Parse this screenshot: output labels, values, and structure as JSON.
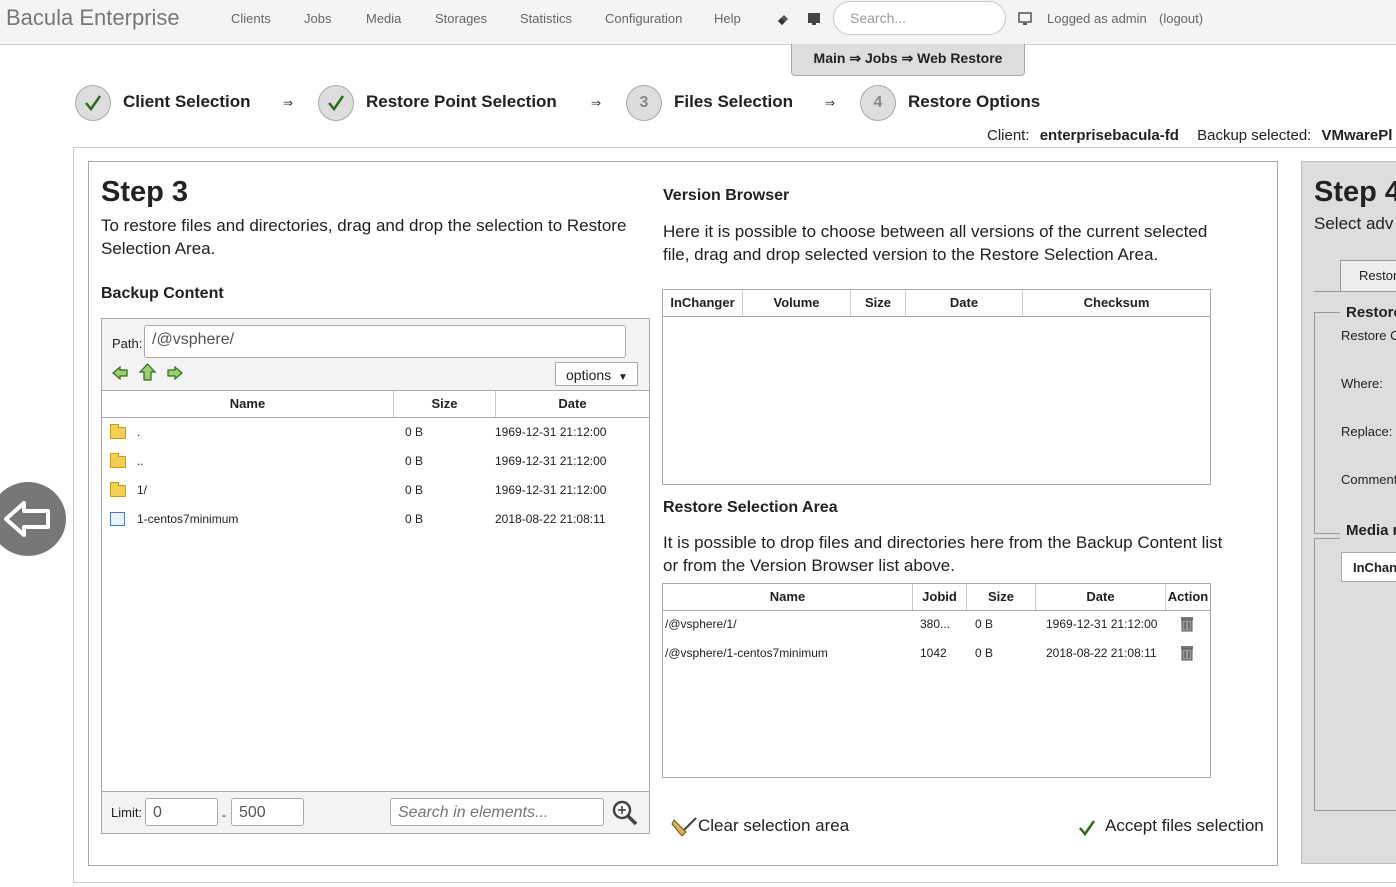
{
  "app": {
    "brand": "Bacula Enterprise"
  },
  "nav": [
    "Clients",
    "Jobs",
    "Media",
    "Storages",
    "Statistics",
    "Configuration",
    "Help"
  ],
  "search": {
    "placeholder": "Search..."
  },
  "user": {
    "logged": "Logged as admin",
    "logout": "(logout)"
  },
  "breadcrumb": "Main ⇒ Jobs ⇒ Web Restore",
  "steps": [
    {
      "label": "Client Selection",
      "state": "done"
    },
    {
      "label": "Restore Point Selection",
      "state": "done"
    },
    {
      "label": "Files Selection",
      "num": "3"
    },
    {
      "label": "Restore Options",
      "num": "4"
    }
  ],
  "step_arrow": "⇒",
  "status": {
    "client_label": "Client:",
    "client_value": "enterprisebacula-fd",
    "backup_label": "Backup selected:",
    "backup_value": "VMwarePl"
  },
  "step3": {
    "title": "Step 3",
    "description": "To restore files and directories, drag and drop the selection to Restore Selection Area.",
    "backup_content": {
      "heading": "Backup Content",
      "path_label": "Path:",
      "path_value": "/@vsphere/",
      "options_label": "options",
      "columns": [
        "Name",
        "Size",
        "Date"
      ],
      "rows": [
        {
          "name": ".",
          "size": "0 B",
          "date": "1969-12-31 21:12:00",
          "type": "folder"
        },
        {
          "name": "..",
          "size": "0 B",
          "date": "1969-12-31 21:12:00",
          "type": "folder"
        },
        {
          "name": "1/",
          "size": "0 B",
          "date": "1969-12-31 21:12:00",
          "type": "folder"
        },
        {
          "name": "1-centos7minimum",
          "size": "0 B",
          "date": "2018-08-22 21:08:11",
          "type": "file"
        }
      ],
      "limit_label": "Limit:",
      "limit_from": "0",
      "limit_dash": "-",
      "limit_to": "500",
      "search_placeholder": "Search in elements..."
    },
    "version_browser": {
      "heading": "Version Browser",
      "description": "Here it is possible to choose between all versions of the current selected file, drag and drop selected version to the Restore Selection Area.",
      "columns": [
        "InChanger",
        "Volume",
        "Size",
        "Date",
        "Checksum"
      ]
    },
    "restore_area": {
      "heading": "Restore Selection Area",
      "description": "It is possible to drop files and directories here from the Backup Content list or from the Version Browser list above.",
      "columns": [
        "Name",
        "Jobid",
        "Size",
        "Date",
        "Action"
      ],
      "rows": [
        {
          "name": "/@vsphere/1/",
          "jobid": "380...",
          "size": "0 B",
          "date": "1969-12-31 21:12:00"
        },
        {
          "name": "/@vsphere/1-centos7minimum",
          "jobid": "1042",
          "size": "0 B",
          "date": "2018-08-22 21:08:11"
        }
      ]
    },
    "clear_label": "Clear selection area",
    "accept_label": "Accept files selection"
  },
  "step4": {
    "title": "Step 4",
    "subtitle": "Select adv",
    "tab": "Restor",
    "group1": "Restore",
    "fields": [
      "Restore C",
      "Where:",
      "Replace:",
      "Comment"
    ],
    "group2": "Media r",
    "col": "InChan"
  }
}
